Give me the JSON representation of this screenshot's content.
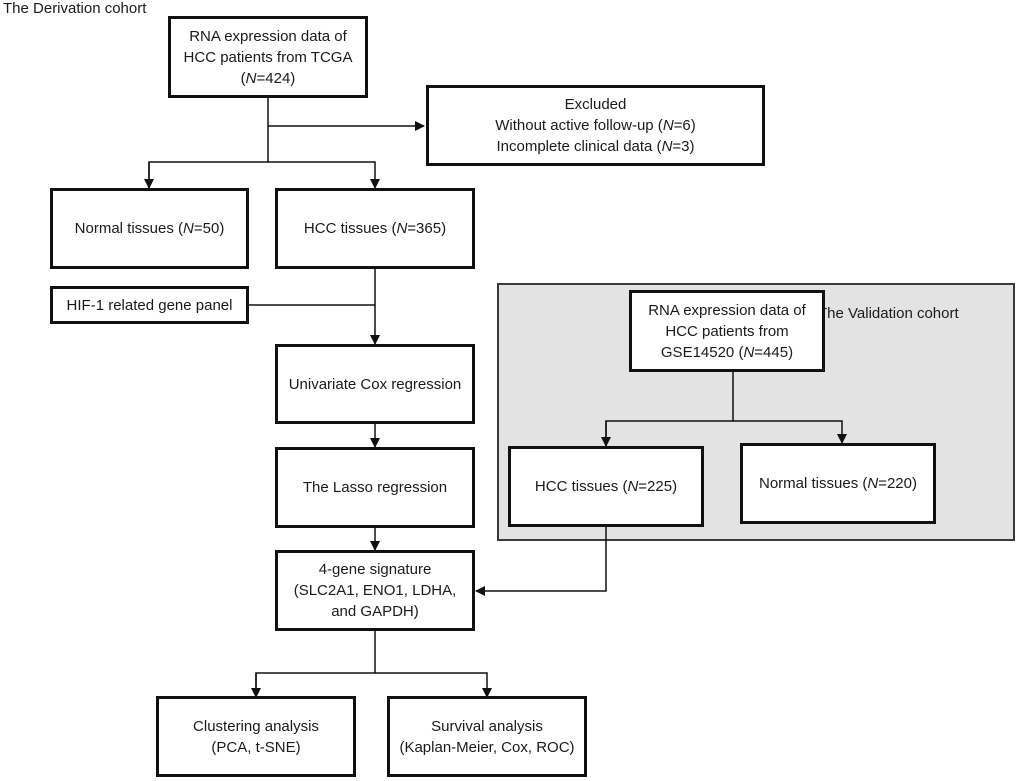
{
  "derivation_label": "The Derivation cohort",
  "validation_label": "The Validation cohort",
  "boxes": {
    "tcga": {
      "lines": [
        "RNA expression data of",
        "HCC patients from TCGA",
        "(N=424)"
      ]
    },
    "excluded": {
      "lines": [
        "Excluded",
        "Without active follow-up (N=6)",
        "Incomplete clinical data (N=3)"
      ]
    },
    "normal_tcga": {
      "lines": [
        "Normal tissues (N=50)"
      ]
    },
    "hcc_tcga": {
      "lines": [
        "HCC tissues (N=365)"
      ]
    },
    "hif_panel": {
      "lines": [
        "HIF-1 related gene panel"
      ]
    },
    "univariate_cox": {
      "lines": [
        "Univariate Cox regression"
      ]
    },
    "lasso": {
      "lines": [
        "The Lasso regression"
      ]
    },
    "signature": {
      "lines": [
        "4-gene signature",
        "(SLC2A1, ENO1, LDHA,",
        "and GAPDH)"
      ]
    },
    "clustering": {
      "lines": [
        "Clustering analysis",
        "(PCA, t-SNE)"
      ]
    },
    "survival": {
      "lines": [
        "Survival analysis",
        "(Kaplan-Meier, Cox, ROC)"
      ]
    },
    "gse": {
      "lines": [
        "RNA expression data of",
        "HCC patients from",
        "GSE14520 (N=445)"
      ]
    },
    "hcc_gse": {
      "lines": [
        "HCC tissues (N=225)"
      ]
    },
    "normal_gse": {
      "lines": [
        "Normal tissues (N=220)"
      ]
    }
  },
  "colors": {
    "panel_bg": "#e3e3e3",
    "border": "#111111"
  }
}
